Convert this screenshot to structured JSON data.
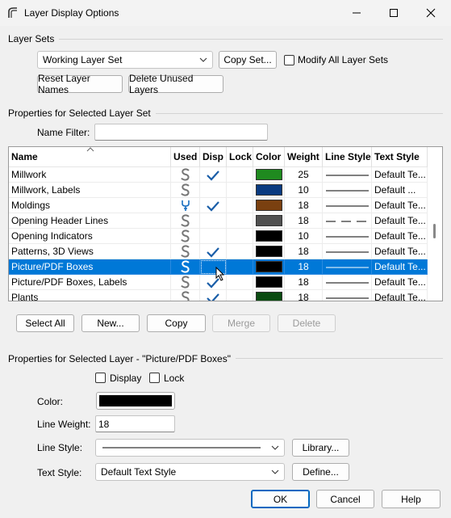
{
  "window": {
    "title": "Layer Display Options"
  },
  "layer_sets": {
    "section_label": "Layer Sets",
    "selected_set": "Working Layer Set",
    "copy_set_label": "Copy Set...",
    "modify_all_label": "Modify All Layer Sets",
    "reset_names_label": "Reset Layer Names",
    "delete_unused_label": "Delete Unused Layers"
  },
  "properties_set": {
    "section_label": "Properties for Selected Layer Set",
    "name_filter_label": "Name Filter:",
    "name_filter_value": ""
  },
  "table": {
    "columns": [
      "Name",
      "Used",
      "Disp",
      "Lock",
      "Color",
      "Weight",
      "Line Style",
      "Text Style"
    ],
    "rows": [
      {
        "name": "Millwork",
        "used": "S",
        "disp": true,
        "lock": false,
        "color": "#1f8a1f",
        "weight": "25",
        "line": "solid",
        "text": "Default Te...",
        "selected": false
      },
      {
        "name": "Millwork, Labels",
        "used": "S",
        "disp": false,
        "lock": false,
        "color": "#0a3a80",
        "weight": "10",
        "line": "solid",
        "text": "Default ...",
        "selected": false
      },
      {
        "name": "Moldings",
        "used": "wrench",
        "disp": true,
        "lock": false,
        "color": "#7a4010",
        "weight": "18",
        "line": "solid",
        "text": "Default Te...",
        "selected": false
      },
      {
        "name": "Opening Header Lines",
        "used": "S",
        "disp": false,
        "lock": false,
        "color": "#505050",
        "weight": "18",
        "line": "dashed",
        "text": "Default Te...",
        "selected": false
      },
      {
        "name": "Opening Indicators",
        "used": "S",
        "disp": false,
        "lock": false,
        "color": "#000000",
        "weight": "10",
        "line": "solid",
        "text": "Default Te...",
        "selected": false
      },
      {
        "name": "Patterns, 3D Views",
        "used": "S",
        "disp": true,
        "lock": false,
        "color": "#000000",
        "weight": "18",
        "line": "solid",
        "text": "Default Te...",
        "selected": false
      },
      {
        "name": "Picture/PDF Boxes",
        "used": "S",
        "disp": false,
        "lock": false,
        "color": "#000000",
        "weight": "18",
        "line": "solid",
        "text": "Default Te...",
        "selected": true
      },
      {
        "name": "Picture/PDF Boxes, Labels",
        "used": "S",
        "disp": true,
        "lock": false,
        "color": "#000000",
        "weight": "18",
        "line": "solid",
        "text": "Default Te...",
        "selected": false
      },
      {
        "name": "Plants",
        "used": "S",
        "disp": true,
        "lock": false,
        "color": "#0a4a10",
        "weight": "18",
        "line": "solid",
        "text": "Default Te...",
        "selected": false
      }
    ]
  },
  "table_buttons": {
    "select_all": "Select All",
    "new": "New...",
    "copy": "Copy",
    "merge": "Merge",
    "delete": "Delete"
  },
  "properties_layer": {
    "section_label": "Properties for Selected Layer - \"Picture/PDF Boxes\"",
    "display_label": "Display",
    "lock_label": "Lock",
    "color_label": "Color:",
    "color_value": "#000000",
    "line_weight_label": "Line Weight:",
    "line_weight_value": "18",
    "line_style_label": "Line Style:",
    "library_label": "Library...",
    "text_style_label": "Text Style:",
    "text_style_value": "Default Text Style",
    "define_label": "Define..."
  },
  "footer": {
    "ok": "OK",
    "cancel": "Cancel",
    "help": "Help"
  }
}
